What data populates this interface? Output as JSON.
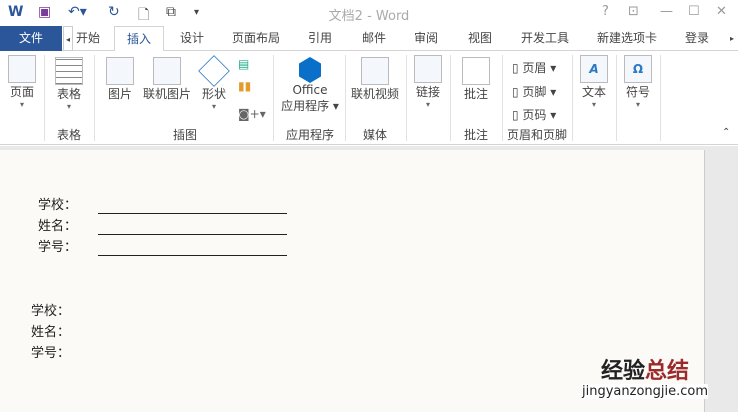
{
  "app": {
    "title": "文档2 - Word"
  },
  "window": {
    "help": "?",
    "restore_ribbon": "⊡",
    "min": "—",
    "max": "☐",
    "close": "✕"
  },
  "tabs": [
    "文件",
    "开始",
    "插入",
    "设计",
    "页面布局",
    "引用",
    "邮件",
    "审阅",
    "视图",
    "开发工具",
    "新建选项卡",
    "登录"
  ],
  "ribbon": {
    "pages": "页面",
    "table": "表格",
    "picture": "图片",
    "online_picture": "联机图片",
    "shapes": "形状",
    "office_1": "Office",
    "office_2": "应用程序",
    "online_video": "联机视频",
    "link": "链接",
    "comment": "批注",
    "header": "页眉",
    "footer": "页脚",
    "page_number": "页码",
    "text": "文本",
    "symbol": "符号",
    "groups": [
      "表格",
      "插图",
      "应用程序",
      "媒体",
      "批注",
      "页眉和页脚"
    ]
  },
  "document": {
    "block1": [
      "学校：",
      "姓名：",
      "学号："
    ],
    "block2": [
      "学校：",
      "姓名：",
      "学号："
    ]
  },
  "watermark": {
    "cn_a": "经验",
    "cn_b": "总结",
    "url": "jingyanzongjie.com"
  },
  "colors": {
    "accent": "#2b579a"
  }
}
